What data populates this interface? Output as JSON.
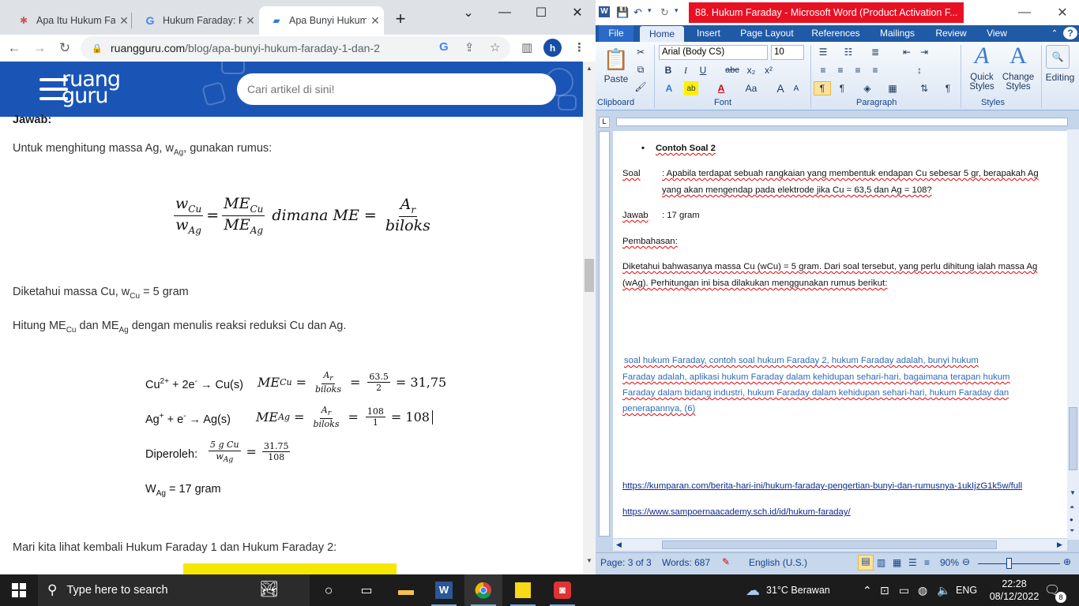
{
  "chrome": {
    "tabs": [
      {
        "title": "Apa Itu Hukum Fa",
        "icon": "wikipedia-like-icon"
      },
      {
        "title": "Hukum Faraday: P",
        "icon": "google-icon"
      },
      {
        "title": "Apa Bunyi Hukum",
        "icon": "ruangguru-icon",
        "active": true
      }
    ],
    "url_host": "ruangguru.com",
    "url_path": "/blog/apa-bunyi-hukum-faraday-1-dan-2",
    "profile_initial": "h"
  },
  "page": {
    "logo_line1": "ruang",
    "logo_line2": "guru",
    "search_placeholder": "Cari artikel di sini!",
    "jawab_label": "Jawab:",
    "p1_pre": "Untuk menghitung massa Ag, w",
    "p1_sub": "Ag",
    "p1_post": ", gunakan rumus:",
    "formula": {
      "w": "w",
      "cu": "Cu",
      "ag": "Ag",
      "me": "ME",
      "dimana": "dimana ME =",
      "ar": "A",
      "r": "r",
      "biloks": "biloks",
      "eq": "="
    },
    "p2_pre": "Diketahui massa Cu, w",
    "p2_sub": "Cu",
    "p2_post": " = 5 gram",
    "p3_a": "Hitung ME",
    "p3_sub1": "Cu",
    "p3_b": " dan ME",
    "p3_sub2": "Ag",
    "p3_c": " dengan menulis reaksi reduksi Cu dan Ag.",
    "r1_lhs_a": "Cu",
    "r1_lhs_sup": "2+",
    "r1_lhs_b": " + 2e",
    "r1_lhs_sup2": "-",
    "r1_lhs_c": " → Cu(s)",
    "r1_num": "63.5",
    "r1_den": "2",
    "r1_result": "= 31,75",
    "r2_lhs_a": "Ag",
    "r2_lhs_sup": "+",
    "r2_lhs_b": " + e",
    "r2_lhs_sup2": "-",
    "r2_lhs_c": " → Ag(s)",
    "r2_num": "108",
    "r2_den": "1",
    "r2_result": "= 108",
    "dip_label": "Diperoleh:",
    "dip_num": "5 g Cu",
    "dip_den": "w",
    "dip_den_sub": "Ag",
    "dip_num2": "31.75",
    "dip_den2": "108",
    "wag_a": "W",
    "wag_sub": "Ag",
    "wag_b": " = 17 gram",
    "closing": "Mari kita lihat kembali Hukum Faraday 1 dan Hukum Faraday 2:"
  },
  "word": {
    "title": "88. Hukum Faraday  -  Microsoft Word (Product Activation F...",
    "tabs": [
      "File",
      "Home",
      "Insert",
      "Page Layout",
      "References",
      "Mailings",
      "Review",
      "View"
    ],
    "font_name": "Arial (Body CS)",
    "font_size": "10",
    "paste": "Paste",
    "groups": {
      "clipboard": "Clipboard",
      "font": "Font",
      "paragraph": "Paragraph",
      "styles": "Styles",
      "editing": "Editing"
    },
    "quick_styles": "Quick Styles",
    "change_styles": "Change Styles",
    "heading": "Contoh Soal 2",
    "soal_label": "Soal",
    "soal_l1": ": Apabila terdapat sebuah rangkaian yang membentuk endapan Cu sebesar 5 gr, berapakah Ag",
    "soal_l2": "yang akan mengendap pada elektrode jika Cu = 63,5 dan Ag = 108?",
    "jawab_label": "Jawab",
    "jawab_val": ": 17 gram",
    "pembahasan": "Pembahasan:",
    "dik_l1": "Diketahui bahwasanya massa Cu (wCu) = 5 gram. Dari soal tersebut, yang perlu dihitung ialah massa Ag",
    "dik_l2": "(wAg). Perhitungan ini bisa dilakukan menggunakan rumus berikut:",
    "tags_l1": "soal hukum Faraday, contoh soal hukum Faraday 2, hukum Faraday adalah, bunyi hukum",
    "tags_l2": "Faraday adalah, aplikasi hukum Faraday dalam kehidupan sehari-hari, bagaimana terapan hukum",
    "tags_l3": "Faraday dalam bidang industri, hukum Faraday dalam kehidupan sehari-hari, hukum Faraday dan",
    "tags_l4": "penerapannya, (6)",
    "link1": "https://kumparan.com/berita-hari-ini/hukum-faraday-pengertian-bunyi-dan-rumusnya-1ukIjzG1k5w/full",
    "link2": "https://www.sampoernaacademy.sch.id/id/hukum-faraday/",
    "status_page": "Page: 3 of 3",
    "status_words": "Words: 687",
    "status_lang": "English (U.S.)",
    "zoom": "90%"
  },
  "taskbar": {
    "search_placeholder": "Type here to search",
    "weather": "31°C  Berawan",
    "lang": "ENG",
    "time": "22:28",
    "date": "08/12/2022",
    "notif_count": "8"
  }
}
